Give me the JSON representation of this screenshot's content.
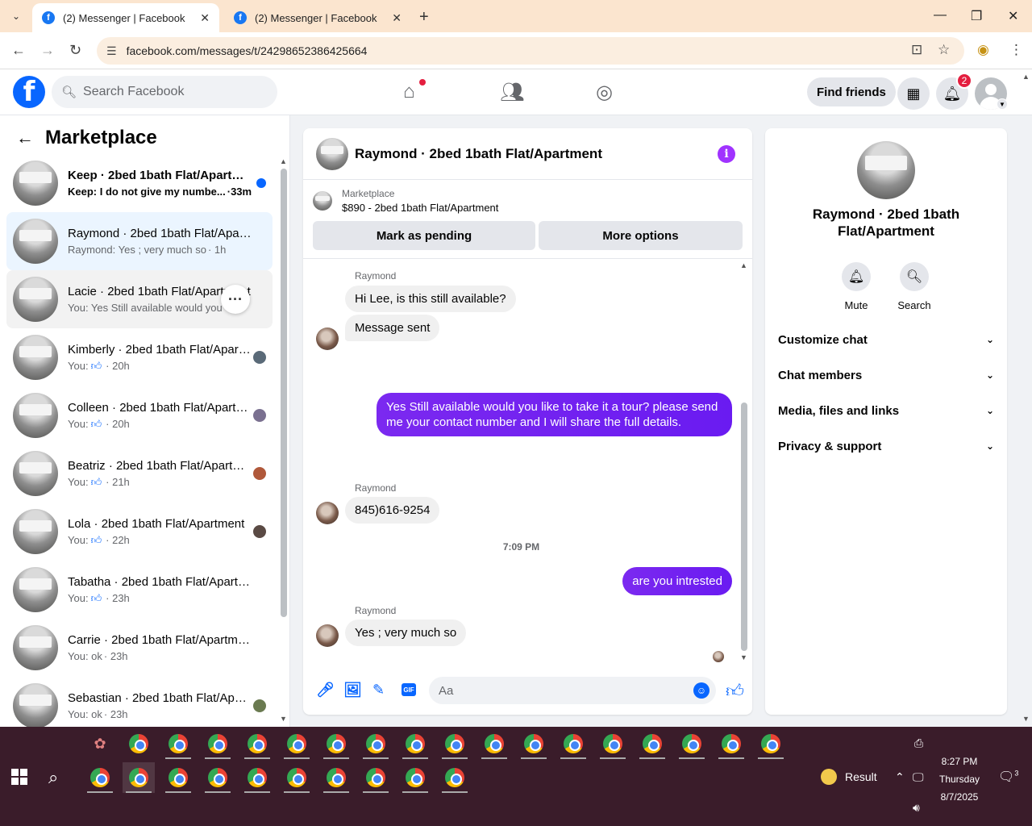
{
  "browser": {
    "tabs": [
      {
        "title": "(2) Messenger | Facebook",
        "active": true
      },
      {
        "title": "(2) Messenger | Facebook",
        "active": false
      }
    ],
    "url": "facebook.com/messages/t/24298652386425664"
  },
  "header": {
    "logo": "f",
    "search_placeholder": "Search Facebook",
    "find_friends": "Find friends",
    "notification_count": "2"
  },
  "sidebar": {
    "title": "Marketplace",
    "conversations": [
      {
        "name": "Keep · 2bed 1bath Flat/Apartment",
        "snippet": "Keep: I do not give my numbe...",
        "time": "·33m",
        "unread": true
      },
      {
        "name": "Raymond · 2bed 1bath Flat/Apartment",
        "snippet": "Raymond: Yes ; very much so",
        "time": "· 1h",
        "selected": true
      },
      {
        "name": "Lacie · 2bed 1bath Flat/Apartment",
        "snippet": "You: Yes Still available would you",
        "time": "· 1h"
      },
      {
        "name": "Kimberly · 2bed 1bath Flat/Apartment",
        "snippet": "You:",
        "time": "· 20h",
        "like": true
      },
      {
        "name": "Colleen · 2bed 1bath Flat/Apartment",
        "snippet": "You:",
        "time": "· 20h",
        "like": true
      },
      {
        "name": "Beatriz · 2bed 1bath Flat/Apartment",
        "snippet": "You:",
        "time": "· 21h",
        "like": true
      },
      {
        "name": "Lola · 2bed 1bath Flat/Apartment",
        "snippet": "You:",
        "time": "· 22h",
        "like": true
      },
      {
        "name": "Tabatha · 2bed 1bath Flat/Apartment",
        "snippet": "You:",
        "time": "· 23h",
        "like": true
      },
      {
        "name": "Carrie · 2bed 1bath Flat/Apartment",
        "snippet": "You: ok",
        "time": "· 23h"
      },
      {
        "name": "Sebastian · 2bed 1bath Flat/Apartment",
        "snippet": "You: ok",
        "time": "· 23h"
      }
    ],
    "more_icon": "···"
  },
  "chat": {
    "title": "Raymond · 2bed 1bath Flat/Apartment",
    "marketplace_label": "Marketplace",
    "listing": "$890 - 2bed 1bath Flat/Apartment",
    "mark_pending": "Mark as pending",
    "more_options": "More options",
    "messages": {
      "sender1": "Raymond",
      "in1": "Hi Lee, is this still available?",
      "in2": "Message sent",
      "out1": "Yes Still available would you like to take it a tour? please send me your contact number and I will share the full details.",
      "sender2": "Raymond",
      "in3": "845)616-9254",
      "timestamp": "7:09 PM",
      "out2": "are you  intrested",
      "sender3": "Raymond",
      "in4": "Yes ; very much so"
    },
    "composer_placeholder": "Aa",
    "gif": "GIF"
  },
  "info_panel": {
    "name": "Raymond · 2bed 1bath Flat/Apartment",
    "mute": "Mute",
    "search": "Search",
    "rows": [
      "Customize chat",
      "Chat members",
      "Media, files and links",
      "Privacy & support"
    ]
  },
  "taskbar": {
    "weather": "Result",
    "time": "8:27 PM",
    "day": "Thursday",
    "date": "8/7/2025",
    "notifications": "3"
  },
  "colors": {
    "brand": "#0866ff",
    "outgoing_bubble": "#7b29f0",
    "info_icon": "#a033ff"
  }
}
